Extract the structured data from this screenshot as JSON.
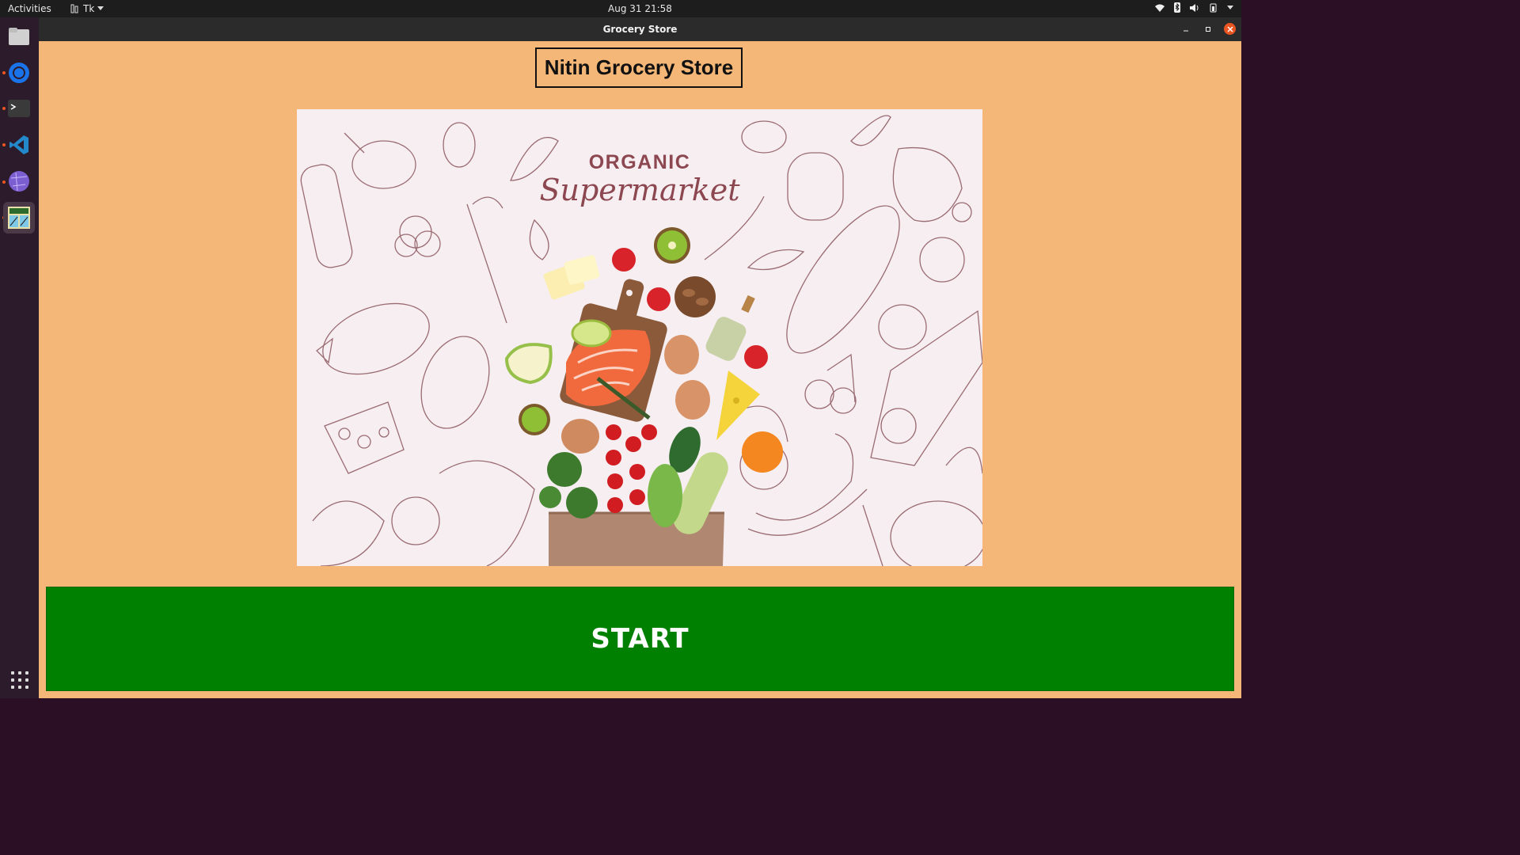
{
  "topbar": {
    "activities": "Activities",
    "app_menu": "Tk",
    "clock": "Aug 31  21:58"
  },
  "dock": {
    "items": [
      "files-icon",
      "browser-icon",
      "terminal-icon",
      "vscode-icon",
      "network-icon",
      "grocery-app-icon"
    ],
    "show_apps": "apps-grid-icon"
  },
  "window": {
    "title": "Grocery Store",
    "heading": "Nitin Grocery Store",
    "banner": {
      "line1": "ORGANIC",
      "line2": "Supermarket"
    },
    "start_button": "START"
  },
  "colors": {
    "window_bg": "#f5b777",
    "start_bg": "#008000",
    "banner_bg": "#f6eef1",
    "accent": "#e95420"
  }
}
